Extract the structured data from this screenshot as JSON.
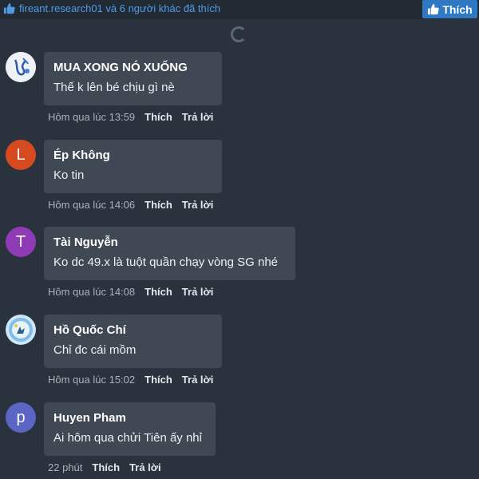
{
  "header": {
    "likes_summary": "fireant.research01 và 6 người khác đã thích",
    "like_button_label": "Thích"
  },
  "comments": [
    {
      "author": "MUA XONG NÓ XUỐNG",
      "text": "Thế k lên bé chịu gì nè",
      "time": "Hôm qua lúc 13:59",
      "like_label": "Thích",
      "reply_label": "Trả lời",
      "avatar_letter": "",
      "avatar_color": "#e6ebf0"
    },
    {
      "author": "Ép Không",
      "text": "Ko tin",
      "time": "Hôm qua lúc 14:06",
      "like_label": "Thích",
      "reply_label": "Trả lời",
      "avatar_letter": "L",
      "avatar_color": "#d64a1f"
    },
    {
      "author": "Tài Nguyễn",
      "text": "Ko dc 49.x là tuột quần chạy vòng SG nhé",
      "time": "Hôm qua lúc 14:08",
      "like_label": "Thích",
      "reply_label": "Trả lời",
      "avatar_letter": "T",
      "avatar_color": "#8e3bb5"
    },
    {
      "author": "Hồ Quốc Chí",
      "text": "Chỉ đc cái mồm",
      "time": "Hôm qua lúc 15:02",
      "like_label": "Thích",
      "reply_label": "Trả lời",
      "avatar_letter": "",
      "avatar_color": "#3b8fd6"
    },
    {
      "author": "Huyen Pham",
      "text": "Ai hôm qua chửi Tiên ấy nhỉ",
      "time": "22 phút",
      "like_label": "Thích",
      "reply_label": "Trả lời",
      "avatar_letter": "p",
      "avatar_color": "#5a65c4"
    }
  ],
  "icons": {
    "like_summary": "thumbs-up-icon",
    "like_button": "thumbs-up-icon",
    "loading": "spinner-icon"
  }
}
